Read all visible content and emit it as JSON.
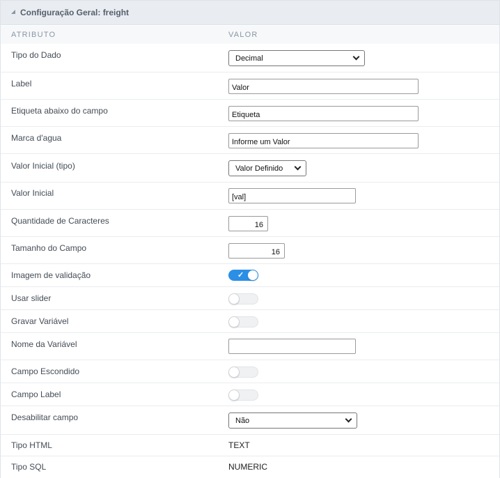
{
  "panel": {
    "title": "Configuração Geral: freight",
    "collapse_icon": "caret-down-icon"
  },
  "columns": {
    "attribute": "ATRIBUTO",
    "value": "VALOR"
  },
  "rows": {
    "tipo_dado": {
      "label": "Tipo do Dado",
      "value": "Decimal"
    },
    "label": {
      "label": "Label",
      "value": "Valor"
    },
    "etiqueta": {
      "label": "Etiqueta abaixo do campo",
      "value": "Etiqueta"
    },
    "marca_dagua": {
      "label": "Marca d'agua",
      "value": "Informe um Valor"
    },
    "valor_inicial_tipo": {
      "label": "Valor Inicial (tipo)",
      "value": "Valor Definido"
    },
    "valor_inicial": {
      "label": "Valor Inicial",
      "value": "[val]"
    },
    "qtd_caracteres": {
      "label": "Quantidade de Caracteres",
      "value": "16"
    },
    "tamanho_campo": {
      "label": "Tamanho do Campo",
      "value": "16"
    },
    "imagem_validacao": {
      "label": "Imagem de validação",
      "checked": true
    },
    "usar_slider": {
      "label": "Usar slider",
      "checked": false
    },
    "gravar_variavel": {
      "label": "Gravar Variável",
      "checked": false
    },
    "nome_variavel": {
      "label": "Nome da Variável",
      "value": ""
    },
    "campo_escondido": {
      "label": "Campo Escondido",
      "checked": false
    },
    "campo_label": {
      "label": "Campo Label",
      "checked": false
    },
    "desabilitar_campo": {
      "label": "Desabilitar campo",
      "value": "Não"
    },
    "tipo_html": {
      "label": "Tipo HTML",
      "value": "TEXT"
    },
    "tipo_sql": {
      "label": "Tipo SQL",
      "value": "NUMERIC"
    }
  },
  "colors": {
    "header_bg": "#e9edf2",
    "toggle_on": "#2b8fe5",
    "toggle_off": "#f0f1f3"
  }
}
